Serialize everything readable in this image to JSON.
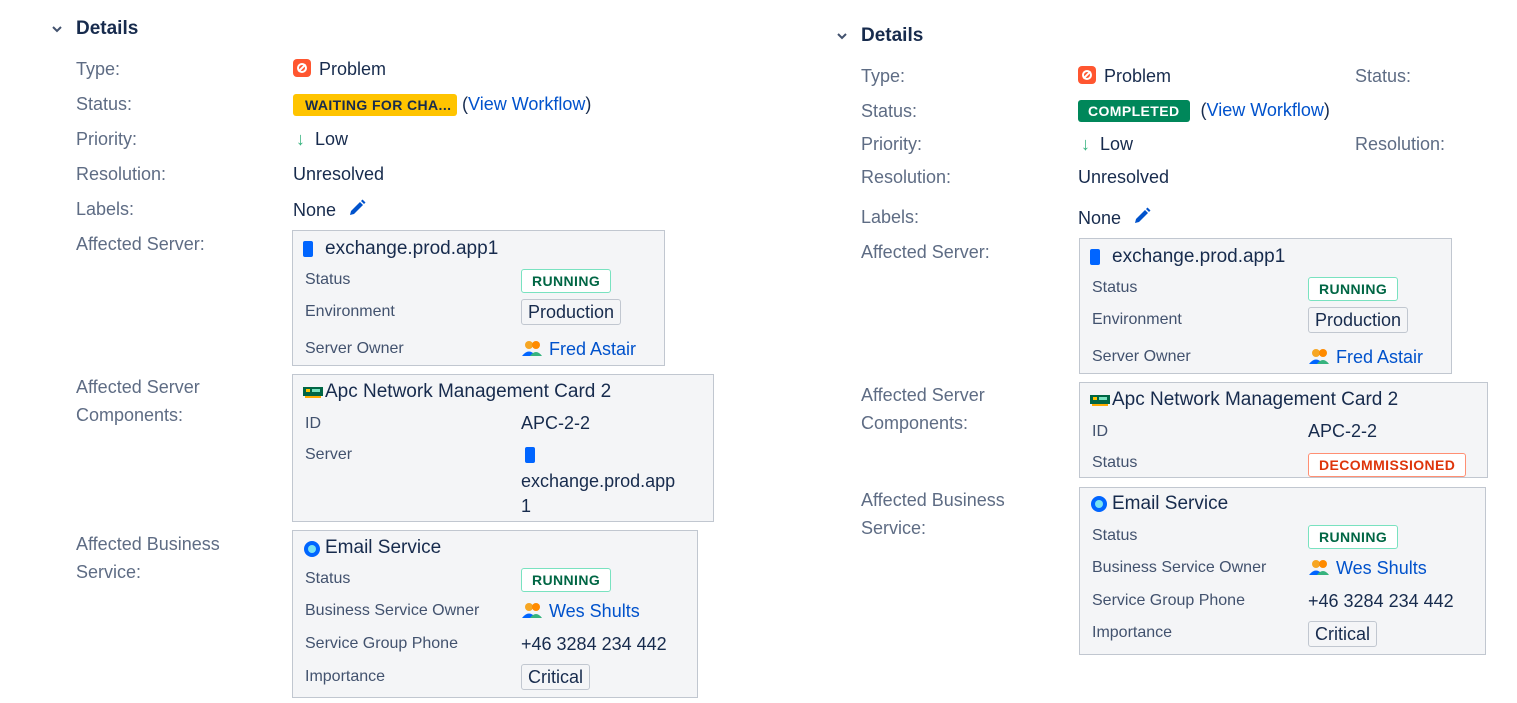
{
  "labels": {
    "type": "Type:",
    "status": "Status:",
    "priority": "Priority:",
    "resolution": "Resolution:",
    "labels": "Labels:",
    "affected_server": "Affected Server:",
    "affected_components_1": "Affected Server",
    "affected_components_2": "Components:",
    "affected_business_1": "Affected Business",
    "affected_business_2": "Service:"
  },
  "left": {
    "heading": "Details",
    "type": "Problem",
    "status": "WAITING FOR CHA...",
    "workflow_open": "(",
    "workflow": "View Workflow",
    "workflow_close": ")",
    "priority": "Low",
    "resolution": "Unresolved",
    "labels": "None",
    "server_card": {
      "title": "exchange.prod.app1",
      "status_label": "Status",
      "status": "RUNNING",
      "env_label": "Environment",
      "env": "Production",
      "owner_label": "Server Owner",
      "owner": "Fred Astair"
    },
    "component_card": {
      "title": "Apc Network Management Card 2",
      "id_label": "ID",
      "id": "APC-2-2",
      "server_label": "Server",
      "server_line1": "exchange.prod.app",
      "server_line2": "1"
    },
    "business_card": {
      "title": "Email Service",
      "status_label": "Status",
      "status": "RUNNING",
      "owner_label": "Business Service Owner",
      "owner": "Wes Shults",
      "phone_label": "Service Group Phone",
      "phone": "+46 3284 234 442",
      "importance_label": "Importance",
      "importance": "Critical"
    }
  },
  "right": {
    "heading": "Details",
    "type": "Problem",
    "status": "COMPLETED",
    "workflow_open": "(",
    "workflow": "View Workflow",
    "workflow_close": ")",
    "priority": "Low",
    "resolution": "Unresolved",
    "labels": "None",
    "side_status": "Status:",
    "side_resolution": "Resolution:",
    "server_card": {
      "title": "exchange.prod.app1",
      "status_label": "Status",
      "status": "RUNNING",
      "env_label": "Environment",
      "env": "Production",
      "owner_label": "Server Owner",
      "owner": "Fred Astair"
    },
    "component_card": {
      "title": "Apc Network Management Card 2",
      "id_label": "ID",
      "id": "APC-2-2",
      "status_label": "Status",
      "status": "DECOMMISSIONED"
    },
    "business_card": {
      "title": "Email Service",
      "status_label": "Status",
      "status": "RUNNING",
      "owner_label": "Business Service Owner",
      "owner": "Wes Shults",
      "phone_label": "Service Group Phone",
      "phone": "+46 3284 234 442",
      "importance_label": "Importance",
      "importance": "Critical"
    }
  },
  "icons": {
    "chevron": "chevron-down-icon",
    "problem": "problem-icon",
    "priority": "arrow-down-icon",
    "edit": "pencil-icon",
    "server": "server-icon",
    "card": "network-card-icon",
    "service": "service-icon",
    "owner": "person-icon"
  },
  "colors": {
    "waiting": "#ffc400",
    "completed": "#00875a",
    "running": "#006644",
    "decommissioned": "#de350b",
    "link": "#0052cc",
    "problem": "#ff5630"
  }
}
